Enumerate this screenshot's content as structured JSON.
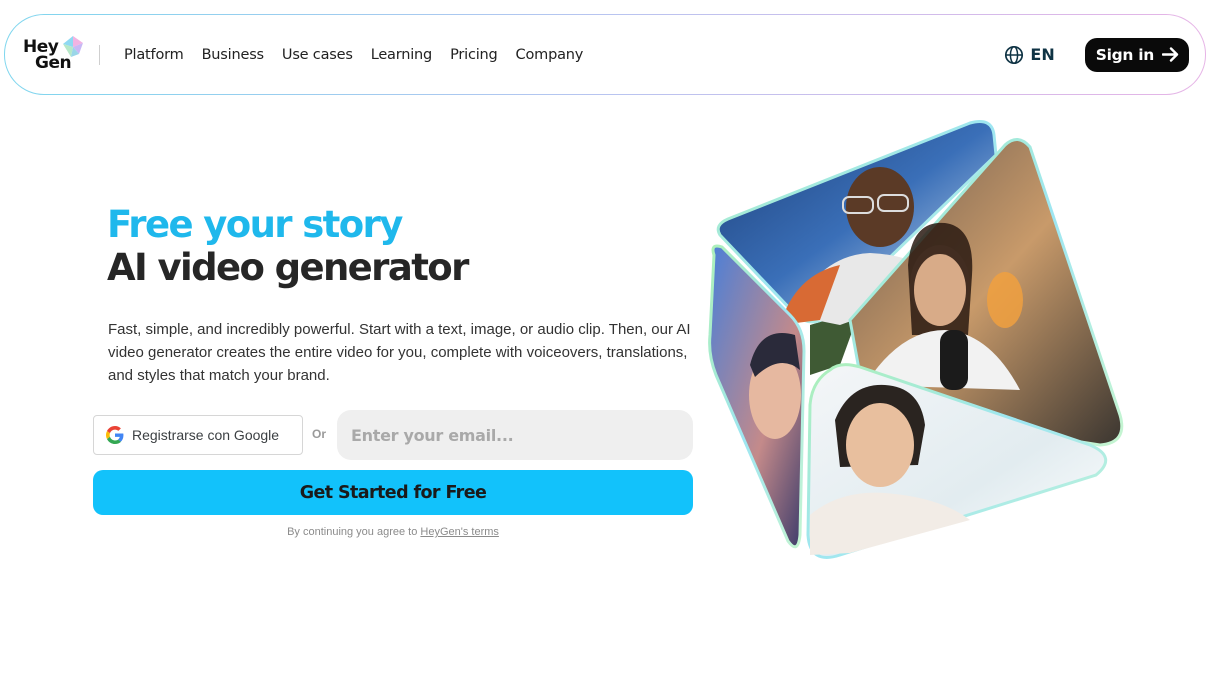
{
  "brand": {
    "logo_line1": "Hey",
    "logo_line2": "Gen"
  },
  "nav": {
    "links": [
      "Platform",
      "Business",
      "Use cases",
      "Learning",
      "Pricing",
      "Company"
    ],
    "language": "EN",
    "signin_label": "Sign in"
  },
  "hero": {
    "title_line1": "Free your story",
    "title_line2": "AI video generator",
    "description": "Fast, simple, and incredibly powerful. Start with a text, image, or audio clip. Then, our AI video generator creates the entire video for you, complete with voiceovers, translations, and styles that match your brand."
  },
  "signup": {
    "google_label": "Registrarse con Google",
    "or_label": "Or",
    "email_placeholder": "Enter your email...",
    "email_value": "",
    "cta_label": "Get Started for Free",
    "terms_prefix": "By continuing you agree to ",
    "terms_link": "HeyGen's terms"
  },
  "colors": {
    "accent_blue": "#1fb8ec",
    "cta_blue": "#12c2fb",
    "signin_bg": "#0a0a0a"
  },
  "icons": [
    "globe-icon",
    "arrow-right-icon",
    "google-icon",
    "heygen-logo-gem"
  ]
}
